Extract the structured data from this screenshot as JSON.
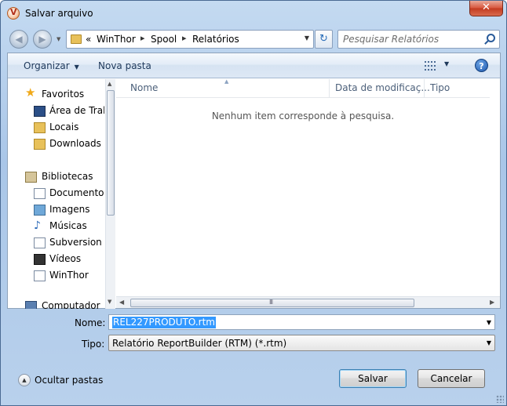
{
  "window": {
    "title": "Salvar arquivo",
    "close_glyph": "✕"
  },
  "address": {
    "back_glyph": "◀",
    "forward_glyph": "▶",
    "chevron": "«",
    "breadcrumbs": [
      "WinThor",
      "Spool",
      "Relatórios"
    ],
    "separator": "▸",
    "search_placeholder": "Pesquisar Relatórios"
  },
  "toolbar": {
    "organize": "Organizar",
    "new_folder": "Nova pasta",
    "help": "?"
  },
  "nav": {
    "favorites": "Favoritos",
    "favorites_items": [
      "Área de Trab",
      "Locais",
      "Downloads"
    ],
    "libraries": "Bibliotecas",
    "libraries_items": [
      "Documentos",
      "Imagens",
      "Músicas",
      "Subversion",
      "Vídeos",
      "WinThor"
    ],
    "computer": "Computador"
  },
  "files": {
    "columns": [
      "Nome",
      "Data de modificaç...",
      "Tipo"
    ],
    "empty_message": "Nenhum item corresponde à pesquisa.",
    "grip": "III"
  },
  "form": {
    "name_label": "Nome:",
    "name_value": "REL227PRODUTO.rtm",
    "type_label": "Tipo:",
    "type_value": "Relatório ReportBuilder (RTM) (*.rtm)"
  },
  "footer": {
    "hide_folders": "Ocultar pastas",
    "save": "Salvar",
    "cancel": "Cancelar"
  }
}
